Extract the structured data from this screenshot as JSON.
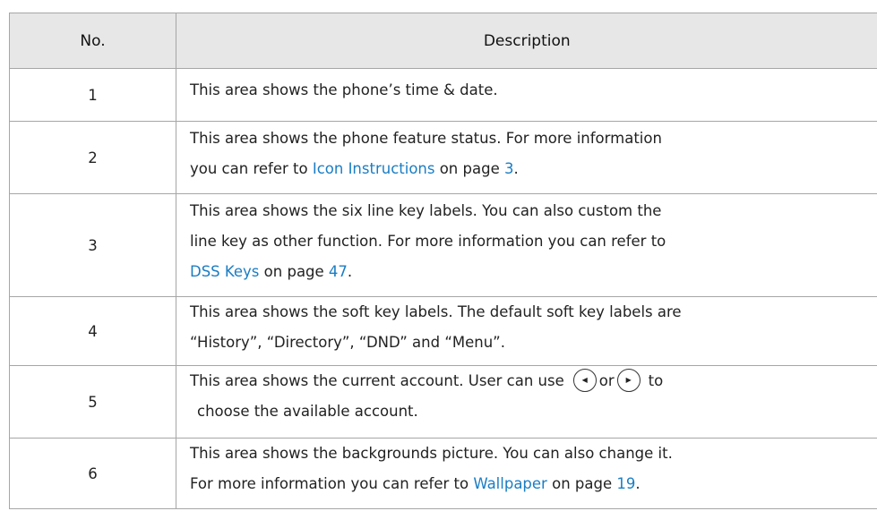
{
  "header": {
    "no": "No.",
    "description": "Description"
  },
  "rows": [
    {
      "no": "1",
      "lines": [
        "This area shows the phone’s time & date."
      ]
    },
    {
      "no": "2",
      "line1": "This area shows the phone feature status. For more information",
      "line2_pre": "you can refer to ",
      "link": "Icon Instructions",
      "line2_mid": " on page ",
      "page": "3",
      "line2_end": "."
    },
    {
      "no": "3",
      "line1": "This area shows the six line key labels. You can also custom the",
      "line2": "line key as other function. For more information you can refer to",
      "link": "DSS Keys",
      "line3_mid": " on page ",
      "page": "47",
      "line3_end": "."
    },
    {
      "no": "4",
      "line1": "This area shows the soft key labels. The default soft key labels are",
      "line2": "“History”, “Directory”, “DND” and “Menu”."
    },
    {
      "no": "5",
      "line1_pre": "This area shows the current account. User can use",
      "left_icon": "left-arrow-key-icon",
      "or": "or",
      "right_icon": "right-arrow-key-icon",
      "line1_end": "to",
      "line2": "choose the available account."
    },
    {
      "no": "6",
      "line1": "This area shows the backgrounds picture. You can also change it.",
      "line2_pre": "For more information you can refer to ",
      "link": "Wallpaper",
      "line2_mid": " on page ",
      "page": "19",
      "line2_end": "."
    }
  ],
  "colors": {
    "header_bg": "#e7e7e7",
    "link": "#1a7dc4",
    "border": "#a6a6a6"
  }
}
